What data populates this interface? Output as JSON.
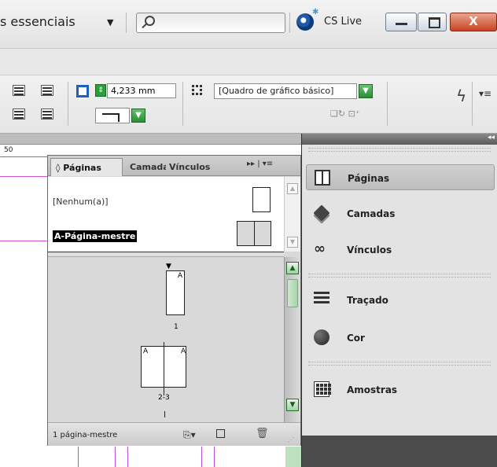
{
  "titlebar": {
    "workspace_label": "s essenciais",
    "workspace_arrow": "▼",
    "search_placeholder": "",
    "cslive_label": "CS Live",
    "close_glyph": "X"
  },
  "toolbar": {
    "stroke_weight": "4,233 mm",
    "object_style": "[Quadro de gráfico básico]",
    "dropdown_glyph": "▼",
    "stepper_glyph": "⇕",
    "mini_icons": "❏↻ ⊡⁺",
    "lightning_glyph": "ϟ",
    "menu_glyph": "▾≡"
  },
  "document": {
    "ruler_value": "50"
  },
  "pages_panel": {
    "tabs": [
      {
        "label": "◊ Páginas"
      },
      {
        "label": "Camadas"
      },
      {
        "label": "Vínculos"
      }
    ],
    "flyout_glyph": "▸▸  |  ▾≡",
    "masters": [
      {
        "label": "[Nenhum(a)]"
      },
      {
        "label": "A-Página-mestre"
      }
    ],
    "pages": [
      {
        "number": "1",
        "master_letter": "A"
      },
      {
        "number": "2-3",
        "master_letters": [
          "A",
          "A"
        ]
      }
    ],
    "footer_status": "1 página-mestre",
    "footer_icons": {
      "new_master": "⎘▾",
      "trash": "🗑"
    }
  },
  "dock": {
    "collapse_glyph": "◂◂",
    "groups": [
      [
        {
          "label": "Páginas",
          "icon": "pages-icon",
          "active": true
        },
        {
          "label": "Camadas",
          "icon": "layers-icon"
        },
        {
          "label": "Vínculos",
          "icon": "links-icon"
        }
      ],
      [
        {
          "label": "Traçado",
          "icon": "stroke-icon"
        },
        {
          "label": "Cor",
          "icon": "color-icon"
        }
      ],
      [
        {
          "label": "Amostras",
          "icon": "swatches-icon"
        }
      ]
    ]
  },
  "colors": {
    "accent_green": "#2f9e3d",
    "close_red": "#c74423",
    "guide_pink": "#d44fd4",
    "guide_purple": "#b44fd8"
  }
}
